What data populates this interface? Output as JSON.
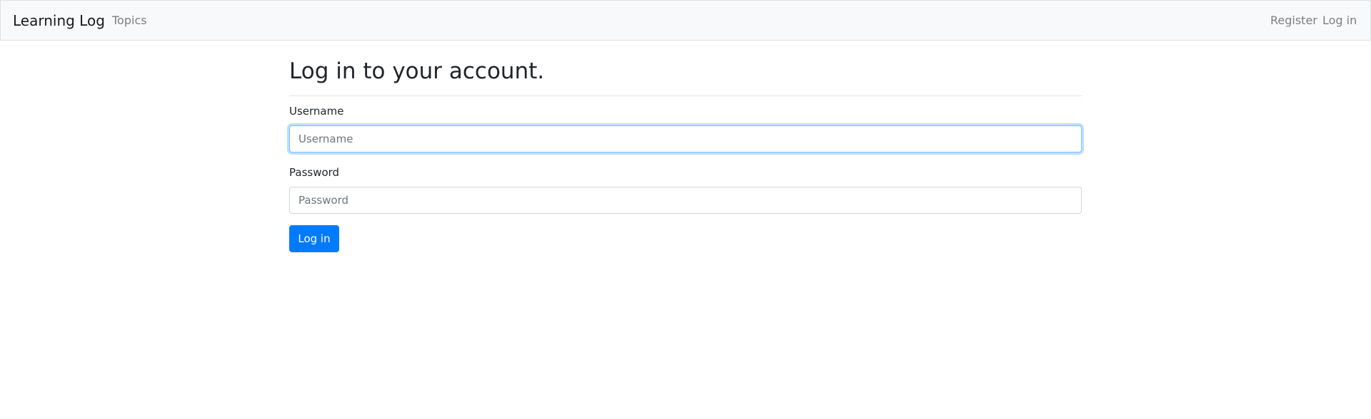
{
  "navbar": {
    "brand": "Learning Log",
    "links": {
      "topics": "Topics",
      "register": "Register",
      "login": "Log in"
    }
  },
  "form": {
    "title": "Log in to your account.",
    "username": {
      "label": "Username",
      "placeholder": "Username",
      "value": ""
    },
    "password": {
      "label": "Password",
      "placeholder": "Password",
      "value": ""
    },
    "submit_label": "Log in"
  },
  "colors": {
    "primary": "#007bff",
    "navbar_bg": "#f8f9fa",
    "focus_ring": "#80bdff"
  }
}
